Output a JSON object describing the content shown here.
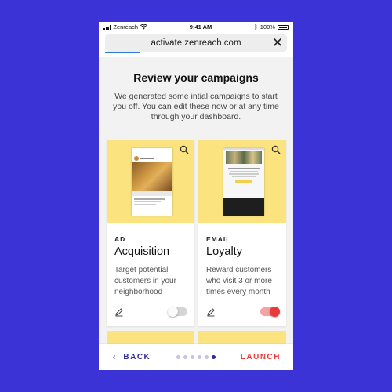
{
  "status_bar": {
    "carrier": "Zenreach",
    "time": "9:41 AM",
    "battery": "100%"
  },
  "browser": {
    "url": "activate.zenreach.com"
  },
  "page": {
    "title": "Review your campaigns",
    "description": "We generated some intial campaigns to start you off. You can edit these now or at any time through your dashboard."
  },
  "cards": [
    {
      "type": "AD",
      "title": "Acquisition",
      "description": "Target potential customers in your neighborhood",
      "enabled": false,
      "preview": "instagram-ad-preview"
    },
    {
      "type": "EMAIL",
      "title": "Loyalty",
      "description": "Reward customers who visit 3 or more times every month",
      "enabled": true,
      "preview": "email-preview"
    }
  ],
  "footer": {
    "back_label": "BACK",
    "launch_label": "LAUNCH",
    "steps_total": 6,
    "steps_current": 6
  },
  "colors": {
    "background": "#3b33d6",
    "card_accent": "#fbe37f",
    "primary": "#2f2a9c",
    "danger": "#e83a3a"
  }
}
